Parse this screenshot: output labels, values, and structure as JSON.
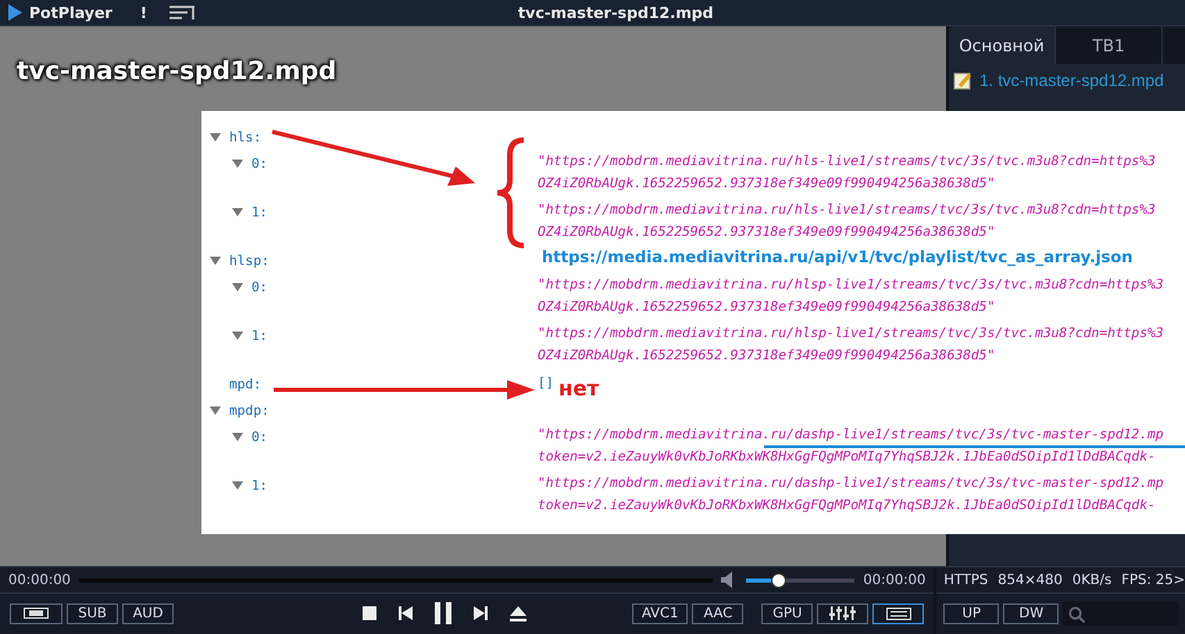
{
  "title_bar": {
    "app_name": "PotPlayer",
    "alert": "!",
    "title": "tvc-master-spd12.mpd"
  },
  "video": {
    "osd_title": "tvc-master-spd12.mpd",
    "image": {
      "tree": [
        {
          "key": "hls:",
          "expanded": true,
          "children": [
            {
              "key": "0:",
              "expanded": true,
              "lines": [
                "\"https://mobdrm.mediavitrina.ru/hls-live1/streams/tvc/3s/tvc.m3u8?cdn=https%3",
                "OZ4iZ0RbAUgk.1652259652.937318ef349e09f990494256a38638d5\""
              ]
            },
            {
              "key": "1:",
              "expanded": true,
              "lines": [
                "\"https://mobdrm.mediavitrina.ru/hls-live1/streams/tvc/3s/tvc.m3u8?cdn=https%3",
                "OZ4iZ0RbAUgk.1652259652.937318ef349e09f990494256a38638d5\""
              ]
            }
          ]
        },
        {
          "key": "hlsp:",
          "expanded": true,
          "children": [
            {
              "key": "0:",
              "expanded": true,
              "lines": [
                "\"https://mobdrm.mediavitrina.ru/hlsp-live1/streams/tvc/3s/tvc.m3u8?cdn=https%3",
                "OZ4iZ0RbAUgk.1652259652.937318ef349e09f990494256a38638d5\""
              ]
            },
            {
              "key": "1:",
              "expanded": true,
              "lines": [
                "\"https://mobdrm.mediavitrina.ru/hlsp-live1/streams/tvc/3s/tvc.m3u8?cdn=https%3",
                "OZ4iZ0RbAUgk.1652259652.937318ef349e09f990494256a38638d5\""
              ]
            }
          ]
        },
        {
          "key": "mpd:",
          "value": "[]"
        },
        {
          "key": "mpdp:",
          "expanded": true,
          "children": [
            {
              "key": "0:",
              "expanded": true,
              "lines": [
                "\"https://mobdrm.mediavitrina.ru/dashp-live1/streams/tvc/3s/tvc-master-spd12.mp",
                "token=v2.ieZauyWk0vKbJoRKbxWK8HxGgFQgMPoMIq7YhqSBJ2k.1JbEa0dSOipId1lDdBACqdk-"
              ]
            },
            {
              "key": "1:",
              "expanded": true,
              "lines": [
                "\"https://mobdrm.mediavitrina.ru/dashp-live1/streams/tvc/3s/tvc-master-spd12.mp",
                "token=v2.ieZauyWk0vKbJoRKbxWK8HxGgFQgMPoMIq7YhqSBJ2k.1JbEa0dSOipId1lDdBACqdk-"
              ]
            }
          ]
        }
      ],
      "annotations": {
        "link": "https://media.mediavitrina.ru/api/v1/tvc/playlist/tvc_as_array.json",
        "note": "нет"
      }
    }
  },
  "playlist": {
    "tabs": [
      {
        "label": "Основной",
        "selected": true
      },
      {
        "label": "ТВ1",
        "selected": false
      }
    ],
    "items": [
      {
        "label": "1. tvc-master-spd12.mpd",
        "selected": true
      }
    ]
  },
  "seek": {
    "elapsed": "00:00:00",
    "total": "00:00:00"
  },
  "volume": {
    "level": 0.3
  },
  "status": [
    "HTTPS",
    "854×480",
    "0KB/s",
    "FPS: 25>"
  ],
  "left_buttons": [
    {
      "kind": "film"
    },
    {
      "kind": "text",
      "label": "SUB"
    },
    {
      "kind": "text",
      "label": "AUD"
    }
  ],
  "transport": [
    {
      "kind": "stop"
    },
    {
      "kind": "prev"
    },
    {
      "kind": "pause"
    },
    {
      "kind": "next"
    },
    {
      "kind": "eject"
    }
  ],
  "right_buttons": [
    {
      "kind": "text",
      "label": "AVC1",
      "selected": false
    },
    {
      "kind": "text",
      "label": "AAC",
      "selected": false
    },
    {
      "kind": "text",
      "label": "GPU",
      "selected": false
    },
    {
      "kind": "equalizer",
      "selected": false
    },
    {
      "kind": "list",
      "selected": true
    }
  ],
  "panel_buttons": [
    {
      "label": "UP"
    },
    {
      "label": "DW"
    }
  ]
}
